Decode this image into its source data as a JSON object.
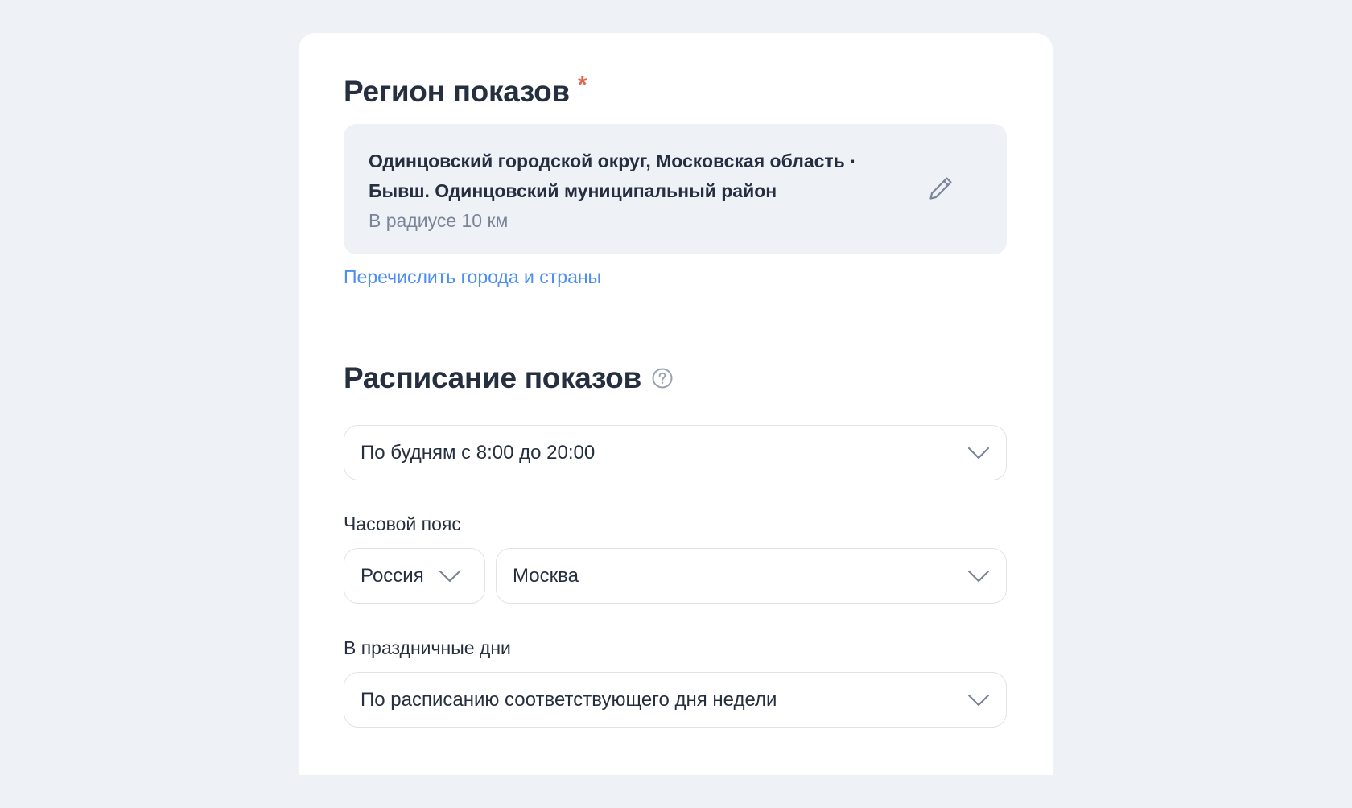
{
  "region": {
    "title": "Регион показов",
    "required_mark": "*",
    "selected_line1": "Одинцовский городской округ, Московская область ·",
    "selected_line2": "Бывш. Одинцовский муниципальный район",
    "radius": "В радиусе 10 км",
    "edit_icon": "pencil-icon",
    "list_link": "Перечислить города и страны"
  },
  "schedule": {
    "title": "Расписание показов",
    "help_icon": "question-circle-icon",
    "selected": "По будням с 8:00 до 20:00",
    "timezone": {
      "label": "Часовой пояс",
      "country": "Россия",
      "city": "Москва"
    },
    "holidays": {
      "label": "В праздничные дни",
      "selected": "По расписанию соответствующего дня недели"
    }
  },
  "colors": {
    "background": "#eef1f6",
    "card": "#ffffff",
    "text": "#262f3f",
    "muted": "#7b8597",
    "link": "#4c8df6",
    "required": "#e06650",
    "border": "#dfe3ea"
  }
}
